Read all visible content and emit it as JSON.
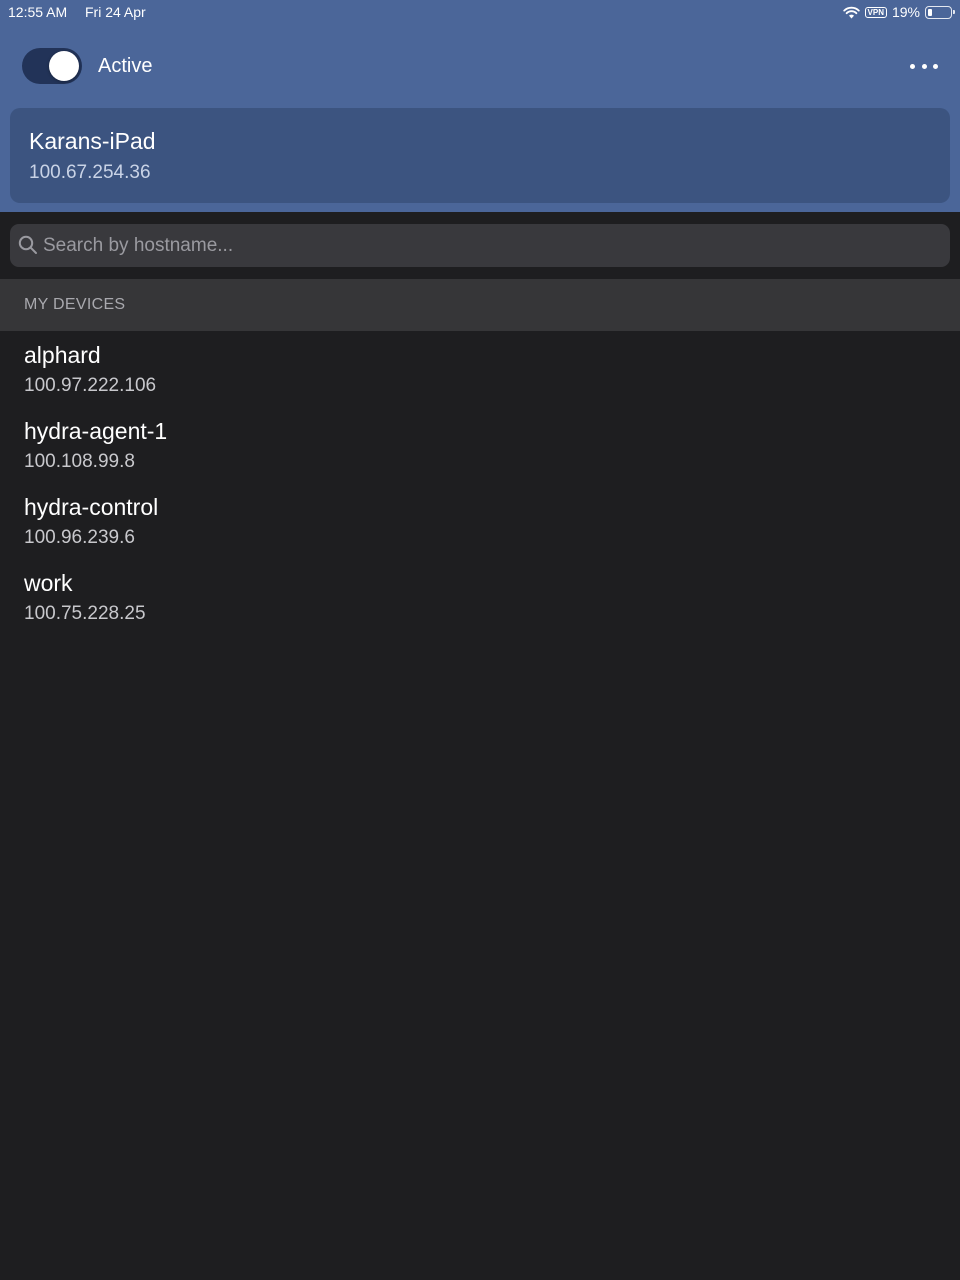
{
  "status_bar": {
    "time": "12:55 AM",
    "date": "Fri 24 Apr",
    "vpn": "VPN",
    "battery_text": "19%",
    "battery_level": 0.19,
    "wifi_icon": "wifi-icon"
  },
  "header": {
    "toggle_on": true,
    "status_label": "Active",
    "more_icon": "more-horizontal-icon"
  },
  "this_device": {
    "name": "Karans-iPad",
    "ip": "100.67.254.36"
  },
  "search": {
    "placeholder": "Search by hostname...",
    "value": ""
  },
  "section": {
    "title": "MY DEVICES"
  },
  "devices": [
    {
      "name": "alphard",
      "ip": "100.97.222.106"
    },
    {
      "name": "hydra-agent-1",
      "ip": "100.108.99.8"
    },
    {
      "name": "hydra-control",
      "ip": "100.96.239.6"
    },
    {
      "name": "work",
      "ip": "100.75.228.25"
    }
  ],
  "colors": {
    "header_bg": "#4b6699",
    "card_bg": "#3c5480",
    "toggle_track": "#223358",
    "app_bg": "#1e1e20",
    "search_bg": "#39393d",
    "section_bg": "#363638"
  }
}
